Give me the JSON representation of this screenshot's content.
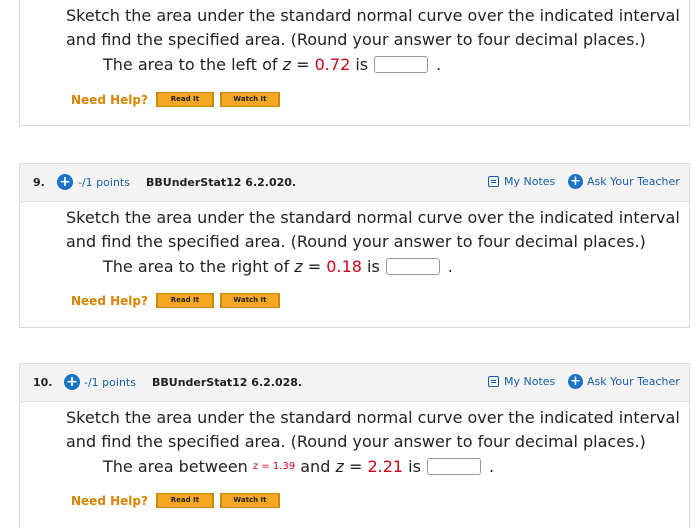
{
  "question_body": "Sketch the area under the standard normal curve over the indicated interval and find the specified area. (Round your answer to four decimal places.)",
  "help": {
    "label": "Need Help?",
    "read_label": "Read It",
    "watch_label": "Watch It"
  },
  "notes_label": "My Notes",
  "ask_label": "Ask Your Teacher",
  "colors": {
    "accent": "#1a73c6",
    "highlight": "#d0021b",
    "help": "#d78400",
    "button": "#f5a623"
  },
  "q8": {
    "prefix": "The area to the left of",
    "var": "z",
    "eq": "=",
    "value": "0.72",
    "is": "is",
    "period": "."
  },
  "q9": {
    "number": "9.",
    "points": "-/1 points",
    "code": "BBUnderStat12 6.2.020.",
    "prefix": "The area to the right of",
    "var": "z",
    "eq": "=",
    "value": "0.18",
    "is": "is",
    "period": "."
  },
  "q10": {
    "number": "10.",
    "points": "-/1 points",
    "code": "BBUnderStat12 6.2.028.",
    "prefix": "The area between",
    "small_expr": "z = 1.39",
    "and": "and",
    "var": "z",
    "eq": "=",
    "value": "2.21",
    "is": "is",
    "period": "."
  }
}
